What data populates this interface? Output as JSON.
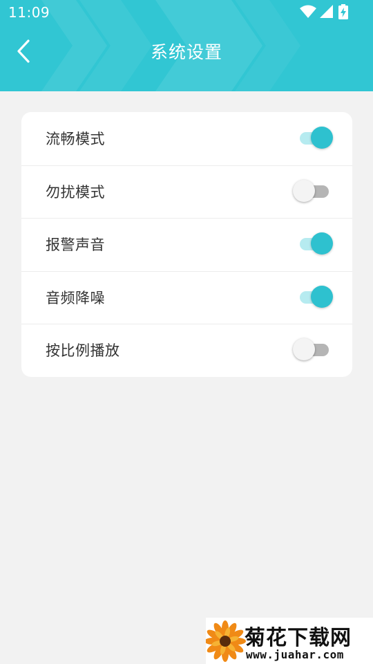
{
  "status_bar": {
    "time": "11:09",
    "icons": [
      "wifi-icon",
      "signal-icon",
      "battery-charging-icon"
    ]
  },
  "header": {
    "title": "系统设置",
    "back_icon": "chevron-left-icon",
    "color": "#31c6d3"
  },
  "settings": [
    {
      "label": "流畅模式",
      "enabled": true
    },
    {
      "label": "勿扰模式",
      "enabled": false
    },
    {
      "label": "报警声音",
      "enabled": true
    },
    {
      "label": "音频降噪",
      "enabled": true
    },
    {
      "label": "按比例播放",
      "enabled": false
    }
  ],
  "colors": {
    "accent": "#2ec1cf",
    "background": "#f2f2f2",
    "card": "#ffffff"
  },
  "watermark": {
    "brand": "菊花下载网",
    "url": "www.juahar.com"
  }
}
